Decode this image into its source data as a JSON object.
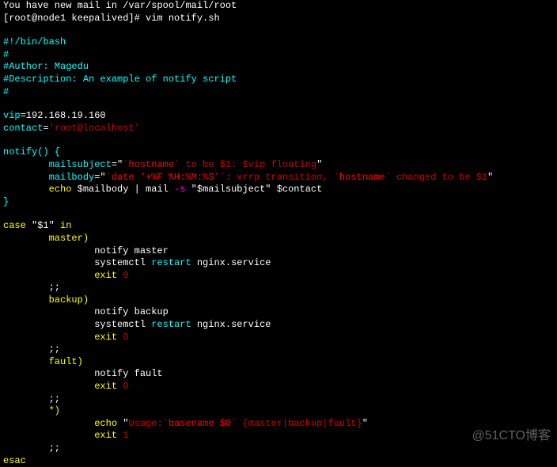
{
  "header": {
    "mail_line": "You have new mail in /var/spool/mail/root",
    "prompt_open": "[root@node1 keepalived]# ",
    "command": "vim notify.sh"
  },
  "script": {
    "shebang": "#!/bin/bash",
    "hash1": "#",
    "author": "#Author: Magedu",
    "description": "#Description: An example of notify script",
    "hash2": "#",
    "vip_key": "vip",
    "vip_eq": "=192.168.19.160",
    "contact_key": "contact",
    "contact_eq": "=",
    "contact_val": "'root@localhost'",
    "notify_fn": "notify() {",
    "mailsubject_key": "        mailsubject",
    "mailsubject_eq": "=",
    "mailsubject_q1": "\"",
    "mailsubject_bt1": "`hostname`",
    "mailsubject_text": " to be $1: $vip floating",
    "mailsubject_q2": "\"",
    "mailbody_key": "        mailbody",
    "mailbody_eq": "=",
    "mailbody_q1": "\"",
    "mailbody_bt1": "`date '+%F %H:%M:%S'`",
    "mailbody_text1": ": vrrp transition, ",
    "mailbody_bt2": "`hostname`",
    "mailbody_text2": " changed to be $1",
    "mailbody_q2": "\"",
    "echo1": "        echo",
    "echo1_body": " $mailbody | ",
    "mail_cmd": "mail ",
    "mail_flag": "-s",
    "mail_subj": " \"$mailsubject\" ",
    "mail_contact": "$contact",
    "brace_close": "}",
    "case_kw": "case",
    "case_var": " \"$1\" ",
    "in_kw": "in",
    "master_label": "        master)",
    "notify_master": "                notify master",
    "sysctl1_cmd": "                systemctl ",
    "sysctl1_restart": "restart",
    "sysctl1_svc": " nginx.service",
    "exit_master": "                exit",
    "zero1": " 0",
    "dsemi1": "        ;;",
    "backup_label": "        backup)",
    "notify_backup": "                notify backup",
    "sysctl2_cmd": "                systemctl ",
    "sysctl2_restart": "restart",
    "sysctl2_svc": " nginx.service",
    "exit_backup": "                exit",
    "zero2": " 0",
    "dsemi2": "        ;;",
    "fault_label": "        fault)",
    "notify_fault": "                notify fault",
    "exit_fault": "                exit",
    "zero3": " 0",
    "dsemi3": "        ;;",
    "default_label": "        *)",
    "echo2": "                echo ",
    "usage_q1": "\"",
    "usage_text1": "Usage:",
    "usage_bt": "`basename $0`",
    "usage_text2": " {master|backup|fault}",
    "usage_q2": "\"",
    "exit_default": "                exit",
    "one": " 1",
    "dsemi4": "        ;;",
    "esac": "esac"
  },
  "watermark": "@51CTO博客"
}
